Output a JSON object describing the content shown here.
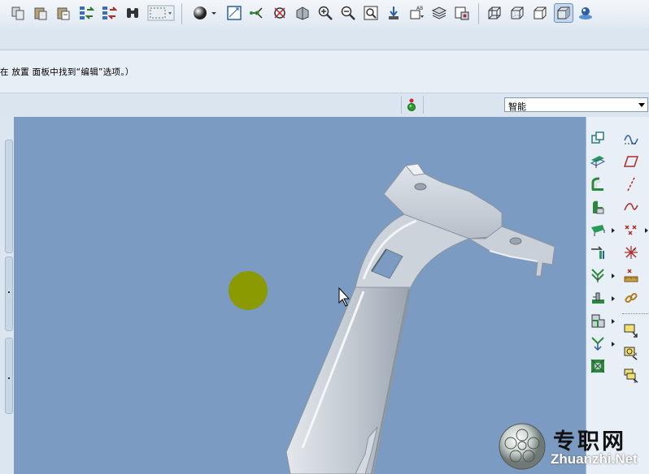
{
  "toolbar": {
    "buttons": [
      "copy-icon",
      "paste-icon",
      "paste-special-icon",
      "regenerate-icon",
      "regenerate-manager-icon",
      "find-icon",
      "select-box-icon",
      "shading-icon",
      "sketch-orient-icon",
      "datum-point-icon",
      "spin-center-icon",
      "view-orient-icon",
      "zoom-in-icon",
      "zoom-out-icon",
      "refit-icon",
      "repaint-icon",
      "annotation-display-icon",
      "layers-icon",
      "view-manager-icon",
      "wireframe-icon",
      "hidden-line-icon",
      "no-hidden-icon",
      "shading-mode-icon",
      "enhanced-realism-icon"
    ],
    "active_button": "shading-mode-icon"
  },
  "message": {
    "text": "在 放置 面板中找到“编辑”选项。）"
  },
  "status": {
    "light_icon": "traffic-light-icon",
    "filter_value": "智能"
  },
  "viewport": {
    "background": "#7b9bc2",
    "model_color": "#c5ccd4",
    "spin_center_color": "#8a9a00"
  },
  "right_panel": {
    "left_column": [
      "copy-surface-icon",
      "offset-icon",
      "thicken-icon",
      "solidify-icon",
      "extend-icon",
      "trim-icon",
      "merge-icon",
      "flatten-icon",
      "round-icon",
      "draft-icon",
      "pattern-icon"
    ],
    "right_column": [
      "datum-curve-icon",
      "datum-plane-icon",
      "datum-axis-icon",
      "sketch-curve-icon",
      "datum-point-icon",
      "coordinate-system-icon",
      "analysis-icon",
      "link-icon",
      "insert-here-icon",
      "feature-icon",
      "group-icon"
    ]
  },
  "watermark": {
    "cn": "专职网",
    "en": "Zhuanzhi.Net"
  }
}
